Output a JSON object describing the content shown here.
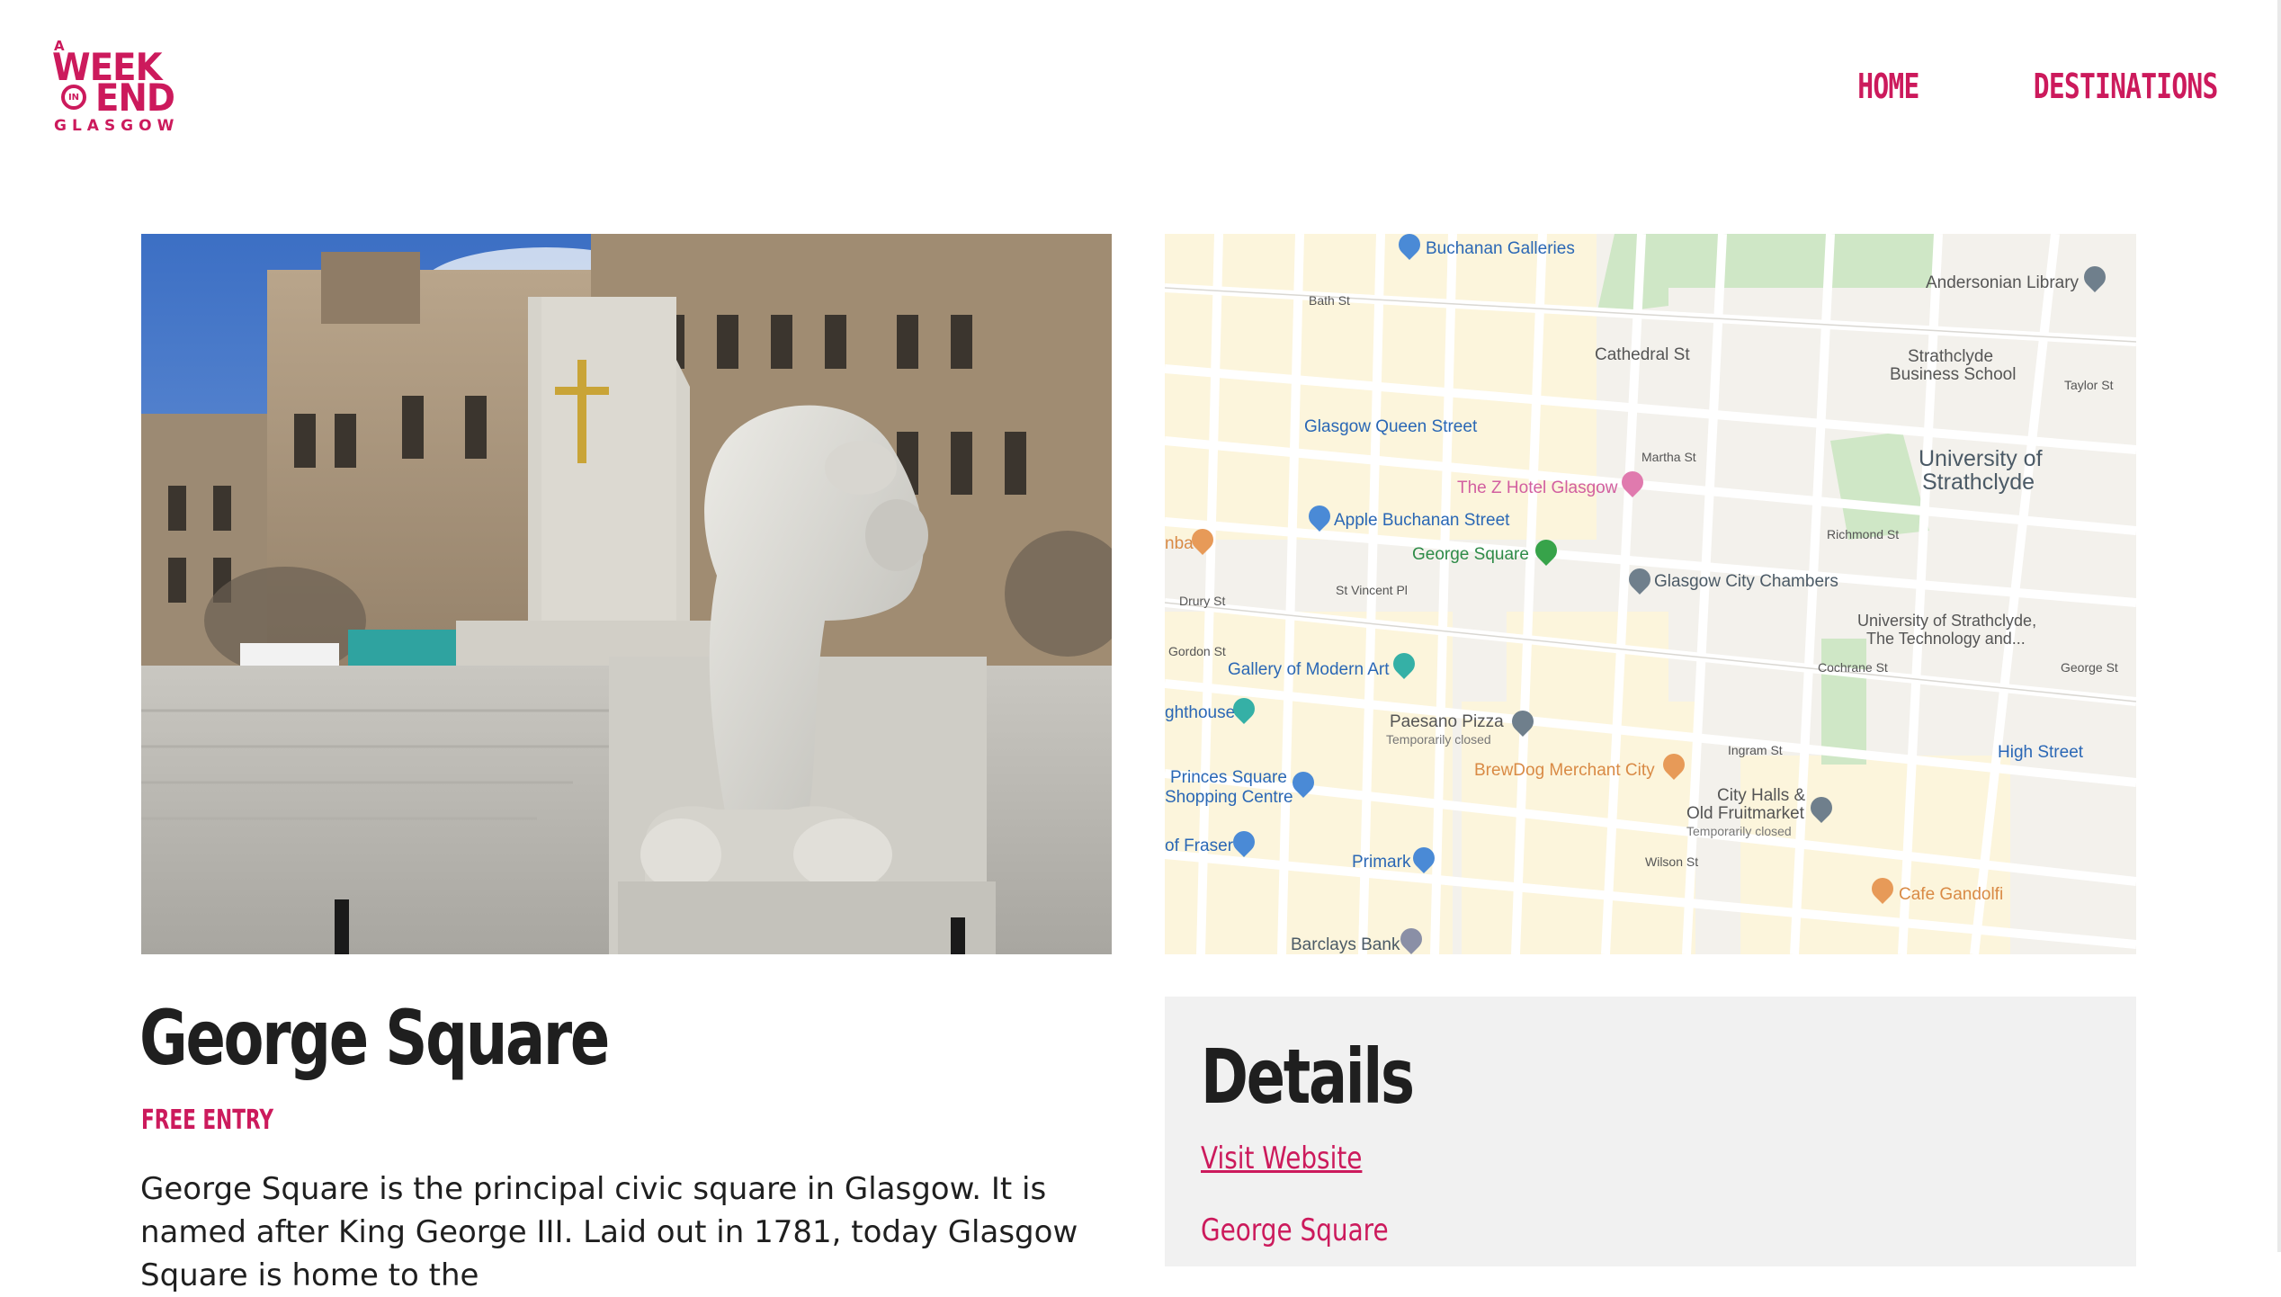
{
  "header": {
    "logo": {
      "a": "A",
      "week": "WEEK",
      "in": "IN",
      "end": "END",
      "city": "GLASGOW"
    },
    "nav": [
      {
        "label": "HOME"
      },
      {
        "label": "DESTINATIONS"
      }
    ]
  },
  "hero": {
    "image_icon": "photo-george-square-lion-statue"
  },
  "map": {
    "labels": [
      "Buchanan Galleries",
      "Bath St",
      "Cathedral St",
      "Andersonian Library",
      "Strathclyde",
      "Business School",
      "Glasgow Queen Street",
      "The Z Hotel Glasgow",
      "Martha St",
      "University of",
      "Strathclyde",
      "Apple Buchanan Street",
      "George Square",
      "St Vincent Pl",
      "Glasgow City Chambers",
      "Richmond St",
      "University of Strathclyde,",
      "The Technology and...",
      "Gallery of Modern Art",
      "Cochrane St",
      "Paesano Pizza",
      "Temporarily closed",
      "BrewDog Merchant City",
      "Ingram St",
      "High Street",
      "Princes Square",
      "Shopping Centre",
      "City Halls &",
      "Old Fruitmarket",
      "Temporarily closed",
      "Primark",
      "Cafe Gandolfi",
      "Barclays Bank",
      "Wilson St",
      "Drury St",
      "Gordon St",
      "Taylor St",
      "George St",
      "ghthouse",
      "of Fraser",
      "nba"
    ]
  },
  "place": {
    "title": "George Square",
    "entry": "FREE ENTRY",
    "description": "George Square is the principal civic square in Glasgow. It is named after King George III. Laid out in 1781, today Glasgow Square is home to the"
  },
  "details": {
    "heading": "Details",
    "website_label": "Visit Website",
    "address": "George Square"
  },
  "colors": {
    "accent": "#cc1a5c",
    "text": "#1f1f1f",
    "panel": "#f1f1f1"
  }
}
